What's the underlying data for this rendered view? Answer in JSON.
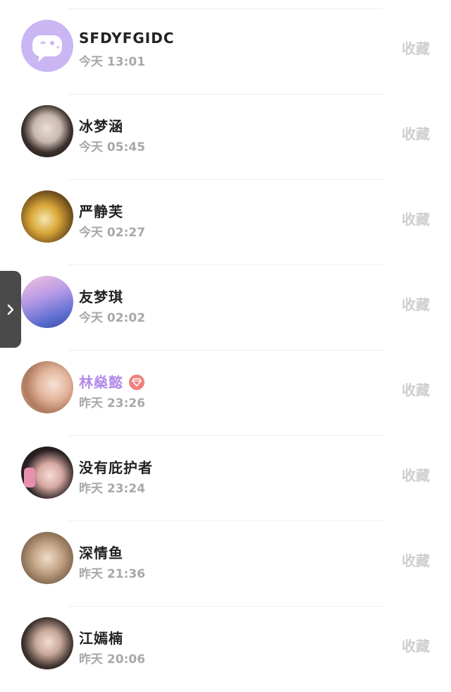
{
  "contacts": [
    {
      "name": "SFDYFGIDC",
      "time": "今天 13:01",
      "action": "收藏"
    },
    {
      "name": "冰梦涵",
      "time": "今天 05:45",
      "action": "收藏"
    },
    {
      "name": "严静芙",
      "time": "今天 02:27",
      "action": "收藏"
    },
    {
      "name": "友梦琪",
      "time": "今天 02:02",
      "action": "收藏"
    },
    {
      "name": "林燊懿",
      "time": "昨天 23:26",
      "action": "收藏"
    },
    {
      "name": "没有庇护者",
      "time": "昨天 23:24",
      "action": "收藏"
    },
    {
      "name": "深情鱼",
      "time": "昨天 21:36",
      "action": "收藏"
    },
    {
      "name": "江嫣楠",
      "time": "昨天 20:06",
      "action": "收藏"
    }
  ],
  "colors": {
    "vip_name": "#b48be8",
    "vip_badge": "#f08080",
    "side_tab": "#4a4a4a"
  },
  "icons": {
    "side_tab": "chevron-right-icon",
    "vip": "diamond-icon",
    "default_avatar": "chat-bubble-icon"
  }
}
